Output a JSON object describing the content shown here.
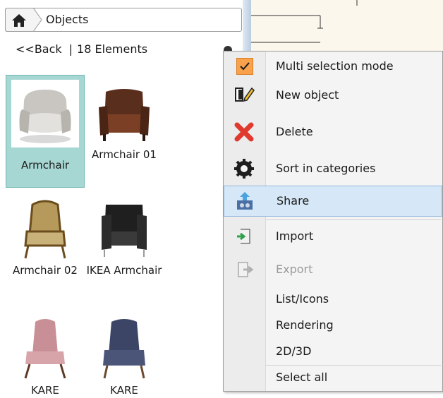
{
  "breadcrumb": {
    "title": "Objects"
  },
  "nav": {
    "back_label": "<<Back",
    "separator": "|",
    "count_label": "18 Elements"
  },
  "objects": [
    {
      "label": "Armchair",
      "selected": true
    },
    {
      "label": "Armchair 01",
      "selected": false
    },
    {
      "label": "Armchair 02",
      "selected": false
    },
    {
      "label": "IKEA Armchair",
      "selected": false
    },
    {
      "label": "KARE",
      "selected": false
    },
    {
      "label": "KARE",
      "selected": false
    }
  ],
  "context_menu": {
    "items": [
      {
        "label": "Multi selection mode",
        "icon": "checkbox-checked-icon",
        "checked": true,
        "enabled": true
      },
      {
        "label": "New object",
        "icon": "new-object-icon",
        "enabled": true
      },
      {
        "label": "Delete",
        "icon": "delete-icon",
        "enabled": true
      },
      {
        "label": "Sort in categories",
        "icon": "gear-icon",
        "enabled": true
      },
      {
        "label": "Share",
        "icon": "share-icon",
        "enabled": true,
        "highlighted": true
      },
      {
        "label": "Import",
        "icon": "import-icon",
        "enabled": true
      },
      {
        "label": "Export",
        "icon": "export-icon",
        "enabled": false
      },
      {
        "label": "List/Icons",
        "enabled": true
      },
      {
        "label": "Rendering",
        "enabled": true
      },
      {
        "label": "2D/3D",
        "enabled": true
      },
      {
        "label": "Select all",
        "enabled": true
      }
    ]
  },
  "colors": {
    "selection": "#a7d7d3",
    "menu_highlight": "#d6e8f7",
    "check": "#f9a14b",
    "delete": "#e03a2f"
  }
}
